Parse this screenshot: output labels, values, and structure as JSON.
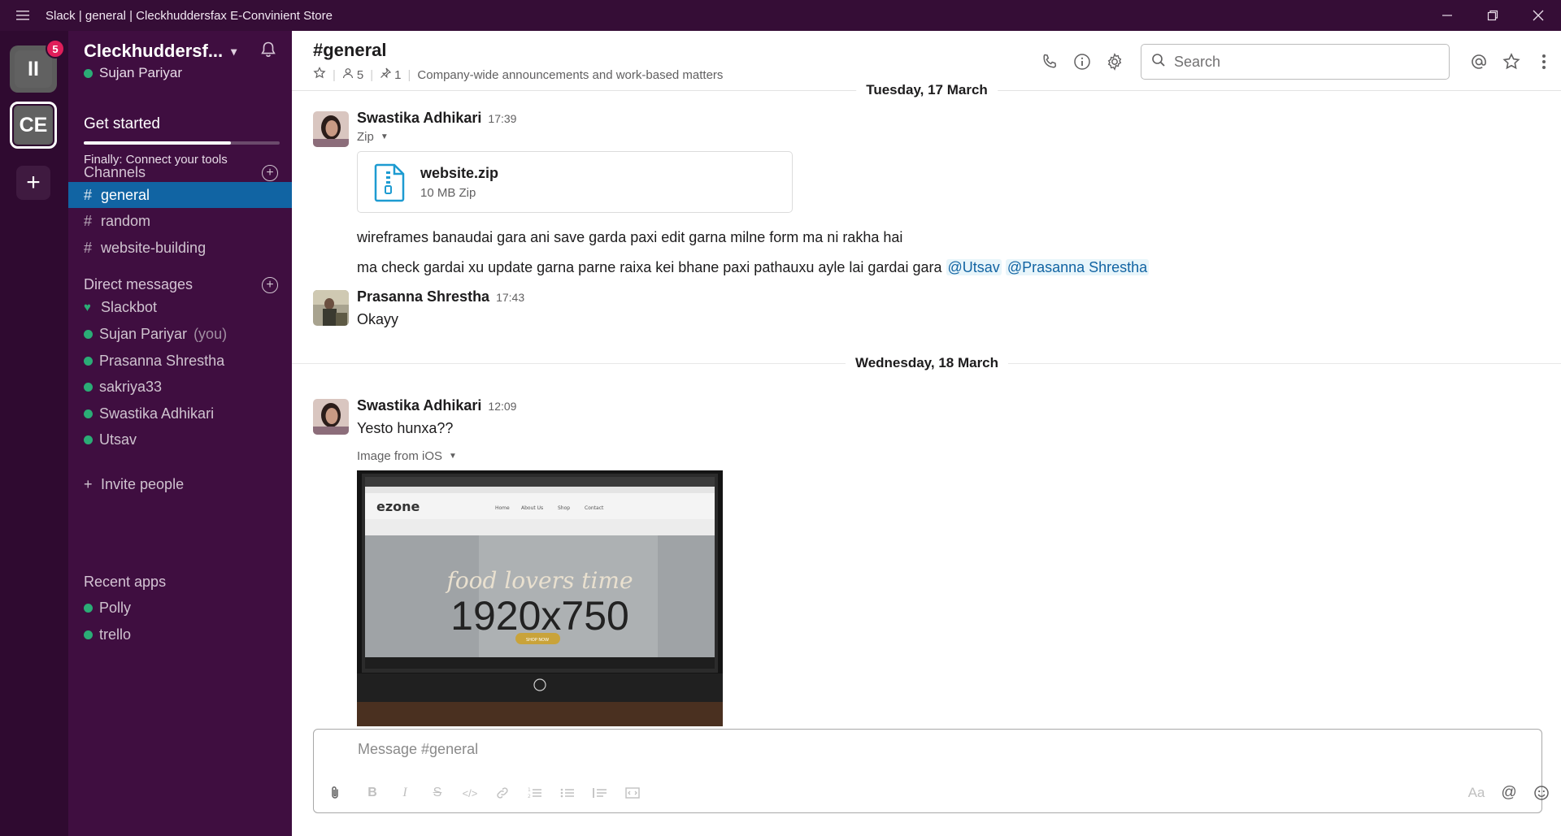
{
  "window": {
    "title": "Slack | general | Cleckhuddersfax E-Convinient Store",
    "menu_icon": "hamburger-icon",
    "controls": [
      "minimize-icon",
      "restore-icon",
      "close-icon"
    ]
  },
  "rail": {
    "workspaces": [
      {
        "label": "II",
        "badge": "5"
      },
      {
        "label": "CE"
      }
    ],
    "add_icon": "plus-icon"
  },
  "sidebar": {
    "workspace_name": "Cleckhuddersf...",
    "user": "Sujan Pariyar",
    "get_started": {
      "title": "Get started",
      "subtitle": "Finally: Connect your tools",
      "progress": 0.75
    },
    "channels_header": "Channels",
    "channels": [
      {
        "name": "general",
        "active": true
      },
      {
        "name": "random"
      },
      {
        "name": "website-building"
      }
    ],
    "dm_header": "Direct messages",
    "dms": [
      {
        "name": "Slackbot",
        "icon": "heart-icon"
      },
      {
        "name": "Sujan Pariyar",
        "suffix": "(you)"
      },
      {
        "name": "Prasanna Shrestha"
      },
      {
        "name": "sakriya33"
      },
      {
        "name": "Swastika Adhikari"
      },
      {
        "name": "Utsav"
      }
    ],
    "invite": "Invite people",
    "apps_header": "Recent apps",
    "apps": [
      {
        "name": "Polly"
      },
      {
        "name": "trello"
      }
    ],
    "colors": {
      "bg": "#3f0e40",
      "active": "#1164a3",
      "presence": "#2bac76"
    }
  },
  "channel": {
    "title": "#general",
    "members": "5",
    "pins": "1",
    "topic": "Company-wide announcements and work-based matters",
    "search_placeholder": "Search"
  },
  "messages": {
    "date1": "Tuesday, 17 March",
    "date2": "Wednesday, 18 March",
    "m1": {
      "author": "Swastika Adhikari",
      "time": "17:39",
      "file_type_label": "Zip",
      "file_name": "website.zip",
      "file_size": "10 MB Zip",
      "line1": "wireframes banaudai gara ani save garda paxi edit garna milne form ma ni rakha hai",
      "line2": "ma check gardai xu update garna parne raixa kei bhane paxi pathauxu ayle lai gardai gara",
      "mention1": "@Utsav",
      "mention2": "@Prasanna Shrestha"
    },
    "m2": {
      "author": "Prasanna Shrestha",
      "time": "17:43",
      "text": "Okayy"
    },
    "m3": {
      "author": "Swastika Adhikari",
      "time": "12:09",
      "text": "Yesto hunxa??",
      "attachment_label": "Image from iOS",
      "image_placeholder": "1920x750",
      "photo_text": {
        "logo": "ezone",
        "nav": [
          "Home",
          "About Us",
          "Shop",
          "Contact"
        ],
        "headline": "food lovers time",
        "button": "SHOP NOW"
      }
    }
  },
  "composer": {
    "placeholder": "Message #general",
    "tools": [
      "attach-icon",
      "bold-icon",
      "italic-icon",
      "strike-icon",
      "code-icon",
      "link-icon",
      "ordered-list-icon",
      "bullet-list-icon",
      "quote-icon",
      "code-block-icon"
    ],
    "right_tools": {
      "format": "Aa",
      "mention": "@",
      "emoji": "emoji-icon"
    }
  }
}
